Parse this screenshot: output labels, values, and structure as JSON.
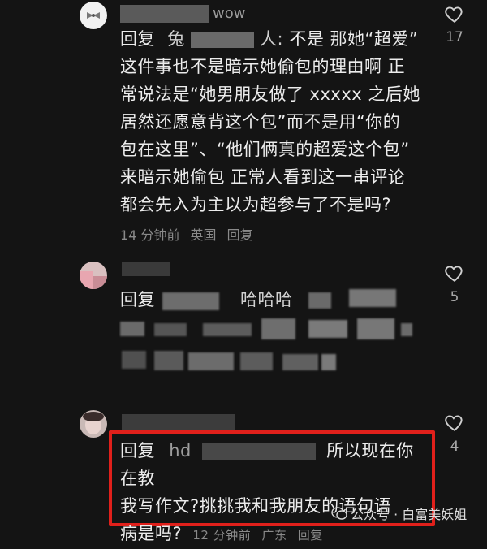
{
  "comments": [
    {
      "username_visible": "wow",
      "reply_prefix": "回复",
      "reply_target_visible_start": "兔",
      "reply_target_visible_end": "人:",
      "text_line1": "不是  那她“超爱”",
      "text_lines": [
        "这件事也不是暗示她偷包的理由啊 正",
        "常说法是“她男朋友做了 xxxxx 之后她",
        "居然还愿意背这个包”而不是用“你的",
        "包在这里”、“他们俩真的超爱这个包”",
        "来暗示她偷包 正常人看到这一串评论",
        "都会先入为主以为超参与了不是吗?"
      ],
      "time": "14 分钟前",
      "location": "英国",
      "reply_action": "回复",
      "likes": "17"
    },
    {
      "reply_prefix": "回复",
      "visible_fragment": "哈哈哈",
      "likes": "5"
    },
    {
      "reply_prefix": "回复",
      "reply_target_visible": "hd",
      "text_line1": "所以现在你在教",
      "text_lines": [
        "我写作文?挑挑我和我朋友的语句语",
        "病是吗?"
      ],
      "time": "12 分钟前",
      "location": "广东",
      "reply_action": "回复",
      "likes": "4"
    }
  ],
  "watermark": "公众号 · 白富美妖姐",
  "colors": {
    "background": "#141414",
    "highlight_box": "#e0201b",
    "meta_text": "#8a8a8a"
  }
}
